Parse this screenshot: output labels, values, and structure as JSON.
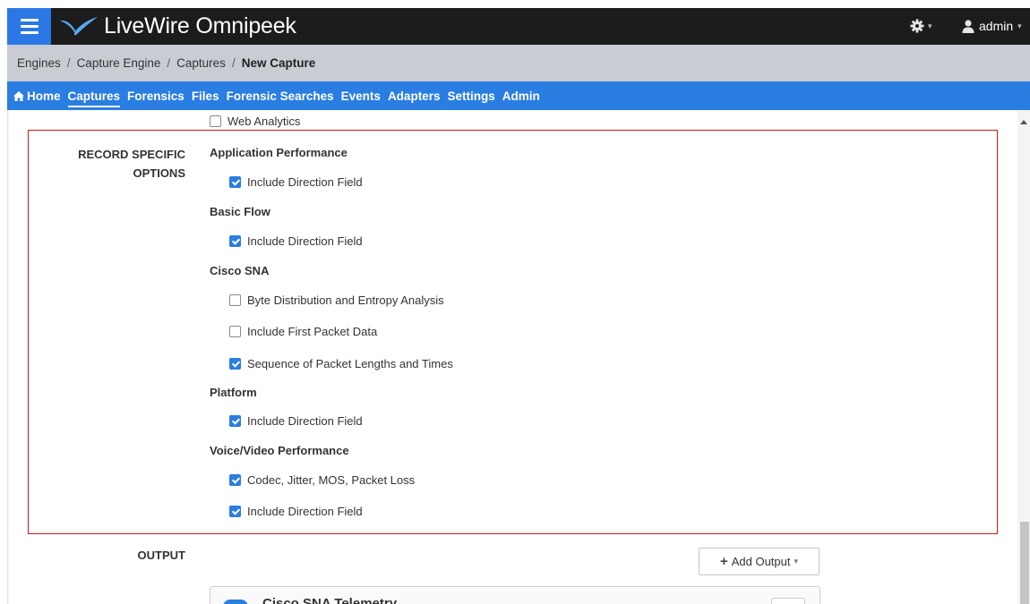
{
  "app": {
    "title": "LiveWire Omnipeek",
    "user": "admin",
    "accent_color": "#2a7de1"
  },
  "breadcrumb": {
    "items": [
      "Engines",
      "Capture Engine",
      "Captures"
    ],
    "current": "New Capture"
  },
  "nav": {
    "items": [
      "Home",
      "Captures",
      "Forensics",
      "Files",
      "Forensic Searches",
      "Events",
      "Adapters",
      "Settings",
      "Admin"
    ],
    "active": "Captures"
  },
  "content": {
    "above_option": {
      "label": "Web Analytics",
      "checked": false
    },
    "record_section_label_line1": "RECORD SPECIFIC",
    "record_section_label_line2": "OPTIONS",
    "groups": [
      {
        "title": "Application Performance",
        "options": [
          {
            "label": "Include Direction Field",
            "checked": true
          }
        ]
      },
      {
        "title": "Basic Flow",
        "options": [
          {
            "label": "Include Direction Field",
            "checked": true
          }
        ]
      },
      {
        "title": "Cisco SNA",
        "options": [
          {
            "label": "Byte Distribution and Entropy Analysis",
            "checked": false
          },
          {
            "label": "Include First Packet Data",
            "checked": false
          },
          {
            "label": "Sequence of Packet Lengths and Times",
            "checked": true
          }
        ]
      },
      {
        "title": "Platform",
        "options": [
          {
            "label": "Include Direction Field",
            "checked": true
          }
        ]
      },
      {
        "title": "Voice/Video Performance",
        "options": [
          {
            "label": "Codec, Jitter, MOS, Packet Loss",
            "checked": true
          },
          {
            "label": "Include Direction Field",
            "checked": true
          }
        ]
      }
    ],
    "output_label": "OUTPUT",
    "add_output_label": "Add Output",
    "output_card_title": "Cisco SNA Telemetry"
  }
}
